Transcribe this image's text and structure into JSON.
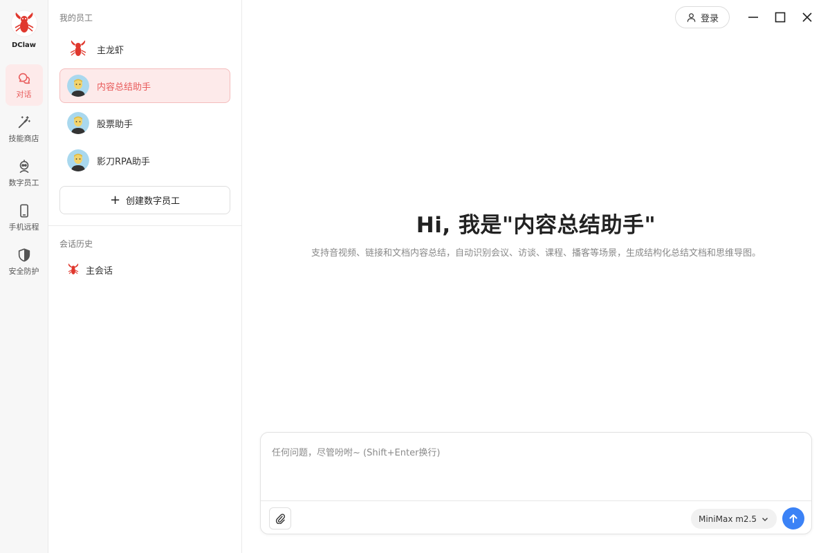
{
  "brand": {
    "name": "DClaw"
  },
  "nav": {
    "items": [
      {
        "label": "对话",
        "icon": "chat-icon",
        "active": true
      },
      {
        "label": "技能商店",
        "icon": "magic-wand-icon",
        "active": false
      },
      {
        "label": "数字员工",
        "icon": "robot-icon",
        "active": false
      },
      {
        "label": "手机远程",
        "icon": "phone-icon",
        "active": false
      },
      {
        "label": "安全防护",
        "icon": "shield-icon",
        "active": false
      }
    ]
  },
  "employees": {
    "section_title": "我的员工",
    "items": [
      {
        "name": "主龙虾",
        "avatar": "lobster-avatar",
        "active": false
      },
      {
        "name": "内容总结助手",
        "avatar": "person-avatar",
        "active": true
      },
      {
        "name": "股票助手",
        "avatar": "person-avatar",
        "active": false
      },
      {
        "name": "影刀RPA助手",
        "avatar": "person-avatar",
        "active": false
      }
    ],
    "create_label": "创建数字员工"
  },
  "history": {
    "section_title": "会话历史",
    "items": [
      {
        "label": "主会话",
        "icon": "lobster-icon"
      }
    ]
  },
  "topbar": {
    "login_label": "登录"
  },
  "hero": {
    "title": "Hi, 我是\"内容总结助手\"",
    "subtitle": "支持音视频、链接和文档内容总结，自动识别会议、访谈、课程、播客等场景，生成结构化总结文档和思维导图。"
  },
  "composer": {
    "placeholder": "任何问题，尽管吩咐~ (Shift+Enter换行)",
    "model": "MiniMax m2.5"
  },
  "colors": {
    "accent": "#e85a5a",
    "accent_bg": "#fdeaea",
    "send": "#3b82f6"
  }
}
